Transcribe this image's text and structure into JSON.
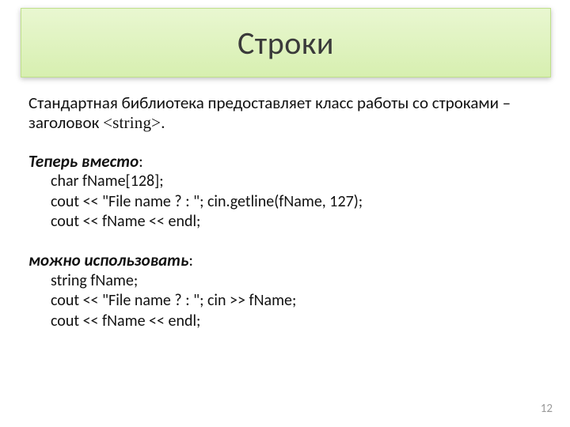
{
  "title": "Строки",
  "intro_part1": "Стандартная библиотека предоставляет класс работы со строками – заголовок ",
  "intro_header": "<string>",
  "intro_part2": ".",
  "section1": {
    "heading": "Теперь вместо",
    "colon": ":",
    "lines": [
      "char fName[128];",
      "cout << \"File name ? : \"; cin.getline(fName, 127);",
      "cout << fName << endl;"
    ]
  },
  "section2": {
    "heading": "можно использовать",
    "colon": ":",
    "lines": [
      "string fName;",
      "cout << \"File name ? : \"; cin >> fName;",
      "cout << fName << endl;"
    ]
  },
  "page_number": "12"
}
